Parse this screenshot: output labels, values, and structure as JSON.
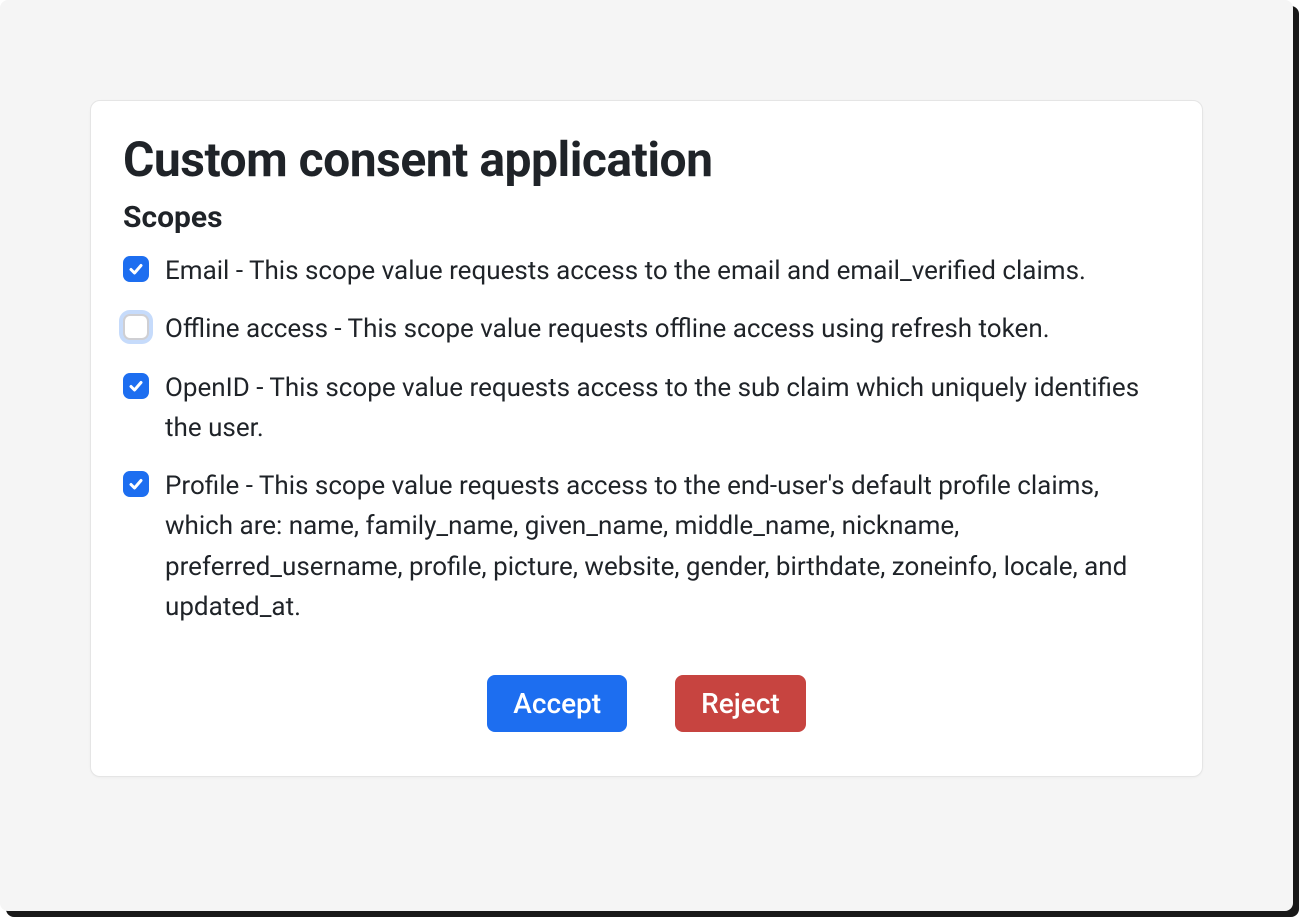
{
  "title": "Custom consent application",
  "subtitle": "Scopes",
  "scopes": [
    {
      "checked": true,
      "label": "Email - This scope value requests access to the email and email_verified claims."
    },
    {
      "checked": false,
      "label": "Offline access - This scope value requests offline access using refresh token."
    },
    {
      "checked": true,
      "label": "OpenID - This scope value requests access to the sub claim which uniquely identifies the user."
    },
    {
      "checked": true,
      "label": "Profile - This scope value requests access to the end-user's default profile claims, which are: name, family_name, given_name, middle_name, nickname, preferred_username, profile, picture, website, gender, birthdate, zoneinfo, locale, and updated_at."
    }
  ],
  "actions": {
    "accept_label": "Accept",
    "reject_label": "Reject"
  },
  "colors": {
    "primary": "#1d6ef0",
    "danger": "#c74440",
    "surface": "#f5f5f5",
    "card": "#ffffff",
    "text": "#1f2328"
  }
}
